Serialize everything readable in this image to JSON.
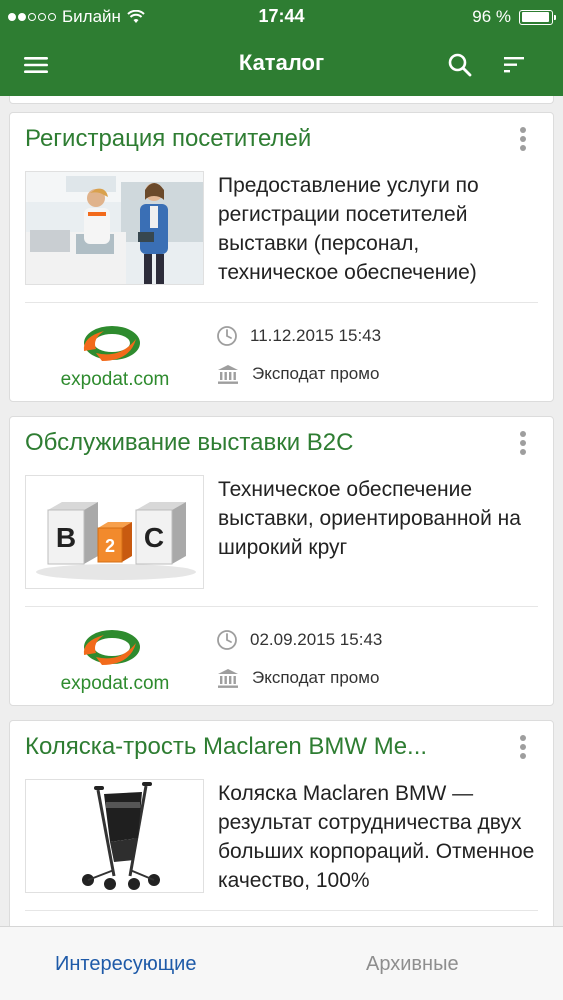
{
  "status_bar": {
    "carrier": "Билайн",
    "time": "17:44",
    "battery_text": "96 %",
    "battery_level": 0.96
  },
  "app_bar": {
    "title": "Каталог",
    "icons": [
      "menu-icon",
      "search-icon",
      "sort-icon"
    ]
  },
  "cards": [
    {
      "title": "Регистрация посетителей",
      "description": "Предоставление услуги по регистрации посетителей выставки (персонал, техническое обеспечение)",
      "image": "registration-desk-photo",
      "logo_text": "expodat.com",
      "date": "11.12.2015 15:43",
      "organizer": "Эксподат промо"
    },
    {
      "title": "Обслуживание выставки B2C",
      "description": "Техническое обеспечение выставки, ориентированной на широкий круг",
      "image": "b2c-cubes-image",
      "image_letters": [
        "B",
        "2",
        "C"
      ],
      "logo_text": "expodat.com",
      "date": "02.09.2015 15:43",
      "organizer": "Эксподат промо"
    },
    {
      "title": "Коляска-трость Maclaren BMW Me...",
      "description": "Коляска Maclaren BMW — результат сотрудничества двух больших корпораций. Отменное качество, 100%",
      "image": "stroller-photo"
    }
  ],
  "tab_bar": {
    "tabs": [
      {
        "label": "Интересующие",
        "active": true
      },
      {
        "label": "Архивные",
        "active": false
      }
    ]
  },
  "colors": {
    "primary": "#2e7d32",
    "tab_active": "#1e5aa8",
    "tab_inactive": "#8e8e8e",
    "logo_green": "#2e8b2e",
    "logo_orange": "#f26a1b"
  }
}
